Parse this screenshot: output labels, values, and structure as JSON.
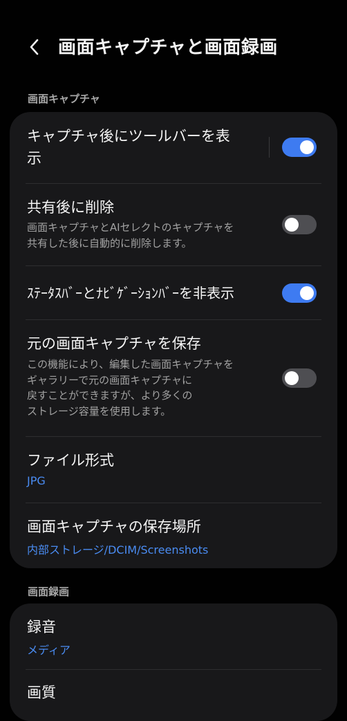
{
  "header": {
    "title": "画面キャプチャと画面録画",
    "back_icon": "chevron-left-icon"
  },
  "screen_capture": {
    "section_label": "画面キャプチャ",
    "toolbar_after_capture": {
      "title_line1": "キャプチャ後にツールバーを表",
      "title_line2": "示",
      "enabled": true
    },
    "delete_after_share": {
      "title": "共有後に削除",
      "desc_line1": "画面キャプチャとAIセレクトのキャプチャを",
      "desc_line2": "共有した後に自動的に削除します。",
      "enabled": false
    },
    "hide_status_nav_bar": {
      "title": "ｽﾃｰﾀｽﾊﾞｰとﾅﾋﾞｹﾞｰｼｮﾝﾊﾞｰを非表示",
      "enabled": true
    },
    "save_original": {
      "title": "元の画面キャプチャを保存",
      "desc_line1": "この機能により、編集した画面キャプチャを",
      "desc_line2": "ギャラリーで元の画面キャプチャに",
      "desc_line3": "戻すことができますが、より多くの",
      "desc_line4": "ストレージ容量を使用します。",
      "enabled": false
    },
    "file_format": {
      "title": "ファイル形式",
      "value": "JPG"
    },
    "save_location": {
      "title": "画面キャプチャの保存場所",
      "value": "内部ストレージ/DCIM/Screenshots"
    }
  },
  "screen_recording": {
    "section_label": "画面録画",
    "audio": {
      "title": "録音",
      "value": "メディア"
    },
    "quality": {
      "title": "画質"
    }
  },
  "colors": {
    "background": "#010101",
    "card": "#18181a",
    "accent": "#3e7bf1",
    "link_value": "#4a8cf2",
    "toggle_off": "#4e4e52"
  }
}
